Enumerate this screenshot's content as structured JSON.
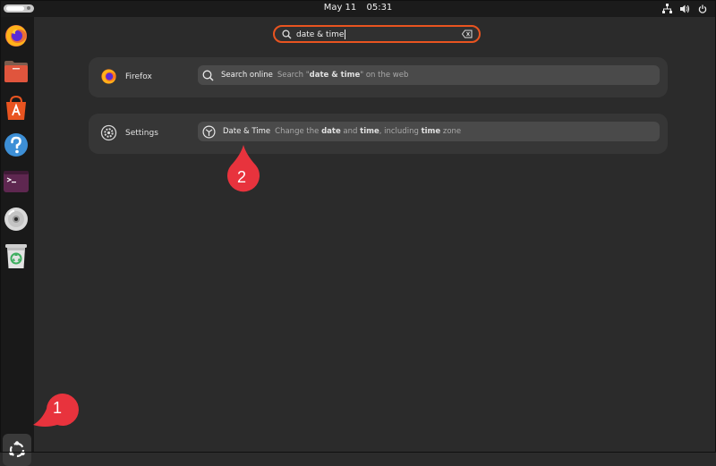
{
  "topbar": {
    "date": "May 11",
    "time": "05:31"
  },
  "search": {
    "query": "date & time"
  },
  "results": {
    "firefox": {
      "provider": "Firefox",
      "title": "Search online",
      "desc_pre": "Search \"",
      "desc_bold": "date & time",
      "desc_post": "\" on the web"
    },
    "settings": {
      "provider": "Settings",
      "title": "Date & Time",
      "desc_1": "Change the ",
      "desc_b1": "date",
      "desc_2": " and ",
      "desc_b2": "time",
      "desc_3": ", including ",
      "desc_b3": "time",
      "desc_4": " zone"
    }
  },
  "dock": {
    "items": [
      "firefox-icon",
      "files-icon",
      "app-center-icon",
      "help-icon",
      "terminal-icon",
      "disc-icon",
      "trash-icon"
    ],
    "app_grid": "ubuntu-logo-icon"
  },
  "annotations": [
    {
      "label": "1",
      "color": "#e8333d"
    },
    {
      "label": "2",
      "color": "#e8333d"
    }
  ],
  "colors": {
    "accent": "#e95420",
    "marker": "#e8333d"
  }
}
